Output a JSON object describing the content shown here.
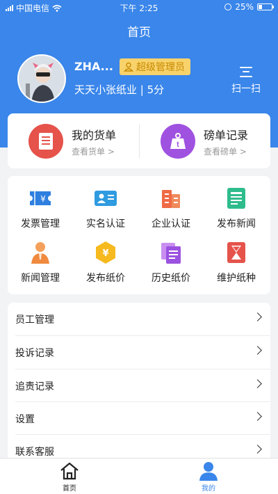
{
  "status_bar": {
    "carrier": "中国电信",
    "time": "下午 2:25",
    "battery": "25%"
  },
  "nav": {
    "title": "首页"
  },
  "profile": {
    "name": "ZHA...",
    "role": "超级管理员",
    "company": "天天小张纸业 | 5分",
    "scan_label": "扫一扫"
  },
  "orders": [
    {
      "title": "我的货单",
      "subtitle": "查看货单 >",
      "icon": "document-icon"
    },
    {
      "title": "磅单记录",
      "subtitle": "查看磅单 >",
      "icon": "scale-weight-icon"
    }
  ],
  "grid": [
    {
      "label": "发票管理",
      "icon": "invoice-icon"
    },
    {
      "label": "实名认证",
      "icon": "id-card-icon"
    },
    {
      "label": "企业认证",
      "icon": "building-icon"
    },
    {
      "label": "发布新闻",
      "icon": "news-icon"
    },
    {
      "label": "新闻管理",
      "icon": "person-icon"
    },
    {
      "label": "发布纸价",
      "icon": "yuan-hexagon-icon"
    },
    {
      "label": "历史纸价",
      "icon": "history-docs-icon"
    },
    {
      "label": "维护纸种",
      "icon": "hourglass-icon"
    }
  ],
  "list": [
    {
      "label": "员工管理"
    },
    {
      "label": "投诉记录"
    },
    {
      "label": "追责记录"
    },
    {
      "label": "设置"
    },
    {
      "label": "联系客服"
    }
  ],
  "tabs": [
    {
      "label": "首页",
      "icon": "home-icon",
      "active": false
    },
    {
      "label": "我的",
      "icon": "user-icon",
      "active": true
    }
  ],
  "colors": {
    "primary": "#3a86ea",
    "badge_bg": "#f8d26b",
    "badge_text": "#c78a00",
    "order_red": "#e5534b",
    "order_purple": "#9f52e0"
  }
}
